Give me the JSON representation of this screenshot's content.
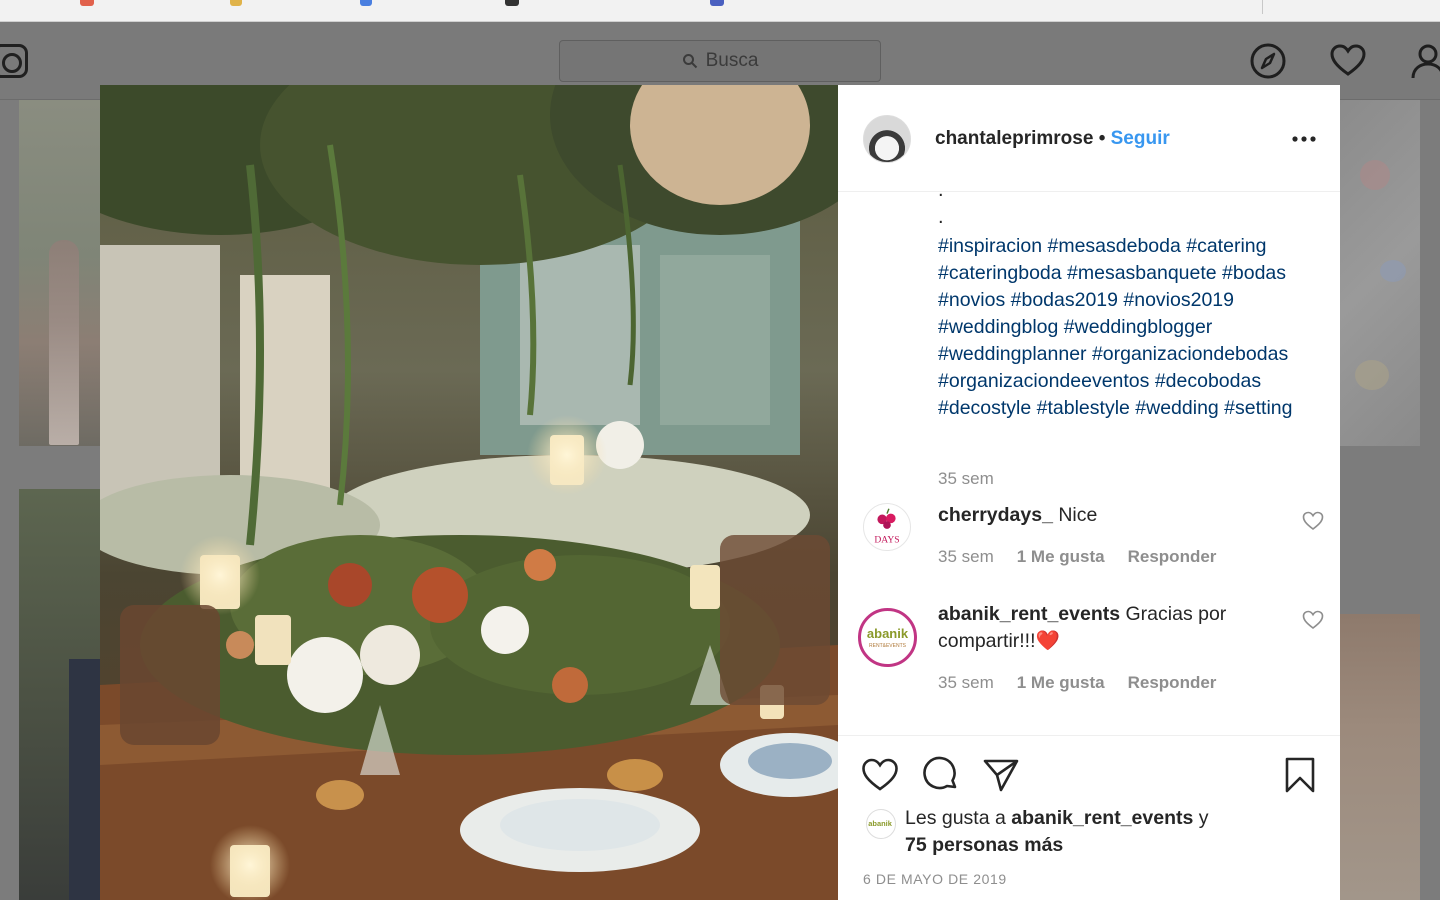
{
  "header": {
    "search_placeholder": "Busca",
    "icons": [
      "instagram-logo-icon",
      "explore-compass-icon",
      "activity-heart-icon",
      "profile-icon"
    ]
  },
  "post": {
    "owner": {
      "username": "chantaleprimrose",
      "separator": "•",
      "follow_label": "Seguir"
    },
    "caption_dots": [
      ".",
      "."
    ],
    "hashtags_text": "#inspiracion #mesasdeboda #catering #cateringboda #mesasbanquete #bodas #novios #bodas2019 #novios2019 #weddingblog #weddingblogger #weddingplanner #organizaciondebodas #organizaciondeeventos #decobodas #decostyle #tablestyle #wedding #setting",
    "caption_time": "35 sem",
    "comments": [
      {
        "username": "cherrydays_",
        "text": "Nice",
        "time": "35 sem",
        "likes": "1 Me gusta",
        "reply_label": "Responder",
        "avatar_text": "Cherry DAYS"
      },
      {
        "username": "abanik_rent_events",
        "text": "Gracias por compartir!!!❤️",
        "time": "35 sem",
        "likes": "1 Me gusta",
        "reply_label": "Responder",
        "avatar_text": "abanik",
        "avatar_subtext": "RENT&EVENTS"
      }
    ],
    "likes_summary": {
      "prefix": "Les gusta a",
      "user": "abanik_rent_events",
      "conjunction": "y",
      "others": "75 personas más",
      "avatar_text": "abanik"
    },
    "date": "6 DE MAYO DE 2019"
  },
  "colors": {
    "link_blue": "#3897f0",
    "hashtag_blue": "#00376b",
    "muted_gray": "#8e8e8e",
    "text_dark": "#262626",
    "overlay_gray": "#7c7c7c"
  }
}
